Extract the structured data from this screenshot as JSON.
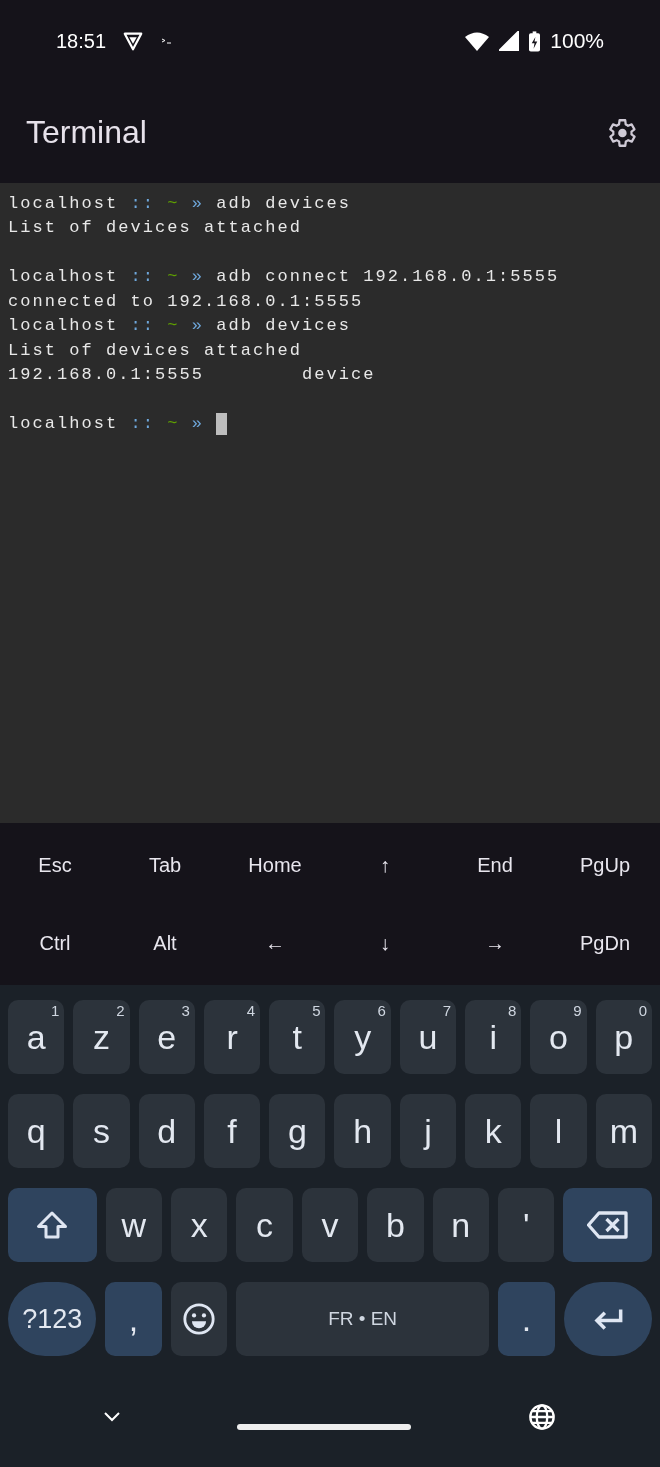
{
  "status_bar": {
    "time": "18:51",
    "battery": "100%"
  },
  "app_bar": {
    "title": "Terminal"
  },
  "terminal": {
    "lines": [
      {
        "kind": "prompt",
        "host": "localhost",
        "sep": "::",
        "dir": "~",
        "arrow": "»",
        "command": "adb devices"
      },
      {
        "kind": "output",
        "text": "List of devices attached"
      },
      {
        "kind": "blank"
      },
      {
        "kind": "prompt",
        "host": "localhost",
        "sep": "::",
        "dir": "~",
        "arrow": "»",
        "command": "adb connect 192.168.0.1:5555"
      },
      {
        "kind": "output",
        "text": "connected to 192.168.0.1:5555"
      },
      {
        "kind": "prompt",
        "host": "localhost",
        "sep": "::",
        "dir": "~",
        "arrow": "»",
        "command": "adb devices"
      },
      {
        "kind": "output",
        "text": "List of devices attached"
      },
      {
        "kind": "output",
        "text": "192.168.0.1:5555        device"
      },
      {
        "kind": "blank"
      },
      {
        "kind": "prompt",
        "host": "localhost",
        "sep": "::",
        "dir": "~",
        "arrow": "»",
        "cursor": true
      }
    ]
  },
  "extra_keys": [
    [
      "Esc",
      "Tab",
      "Home",
      "↑",
      "End",
      "PgUp"
    ],
    [
      "Ctrl",
      "Alt",
      "←",
      "↓",
      "→",
      "PgDn"
    ]
  ],
  "keyboard": {
    "key_rows": [
      {
        "keys": [
          {
            "kind": "letter",
            "label": "a",
            "hint": "1"
          },
          {
            "kind": "letter",
            "label": "z",
            "hint": "2"
          },
          {
            "kind": "letter",
            "label": "e",
            "hint": "3"
          },
          {
            "kind": "letter",
            "label": "r",
            "hint": "4"
          },
          {
            "kind": "letter",
            "label": "t",
            "hint": "5"
          },
          {
            "kind": "letter",
            "label": "y",
            "hint": "6"
          },
          {
            "kind": "letter",
            "label": "u",
            "hint": "7"
          },
          {
            "kind": "letter",
            "label": "i",
            "hint": "8"
          },
          {
            "kind": "letter",
            "label": "o",
            "hint": "9"
          },
          {
            "kind": "letter",
            "label": "p",
            "hint": "0"
          }
        ]
      },
      {
        "keys": [
          {
            "kind": "letter",
            "label": "q"
          },
          {
            "kind": "letter",
            "label": "s"
          },
          {
            "kind": "letter",
            "label": "d"
          },
          {
            "kind": "letter",
            "label": "f"
          },
          {
            "kind": "letter",
            "label": "g"
          },
          {
            "kind": "letter",
            "label": "h"
          },
          {
            "kind": "letter",
            "label": "j"
          },
          {
            "kind": "letter",
            "label": "k"
          },
          {
            "kind": "letter",
            "label": "l"
          },
          {
            "kind": "letter",
            "label": "m"
          }
        ]
      },
      {
        "keys": [
          {
            "kind": "shift"
          },
          {
            "kind": "letter",
            "label": "w"
          },
          {
            "kind": "letter",
            "label": "x"
          },
          {
            "kind": "letter",
            "label": "c"
          },
          {
            "kind": "letter",
            "label": "v"
          },
          {
            "kind": "letter",
            "label": "b"
          },
          {
            "kind": "letter",
            "label": "n"
          },
          {
            "kind": "letter",
            "label": "'"
          },
          {
            "kind": "backspace"
          }
        ]
      },
      {
        "keys": [
          {
            "kind": "symbols",
            "label": "?123"
          },
          {
            "kind": "punct",
            "label": ","
          },
          {
            "kind": "emoji"
          },
          {
            "kind": "space",
            "label": "FR • EN"
          },
          {
            "kind": "punct",
            "label": "."
          },
          {
            "kind": "enter"
          }
        ]
      }
    ]
  }
}
